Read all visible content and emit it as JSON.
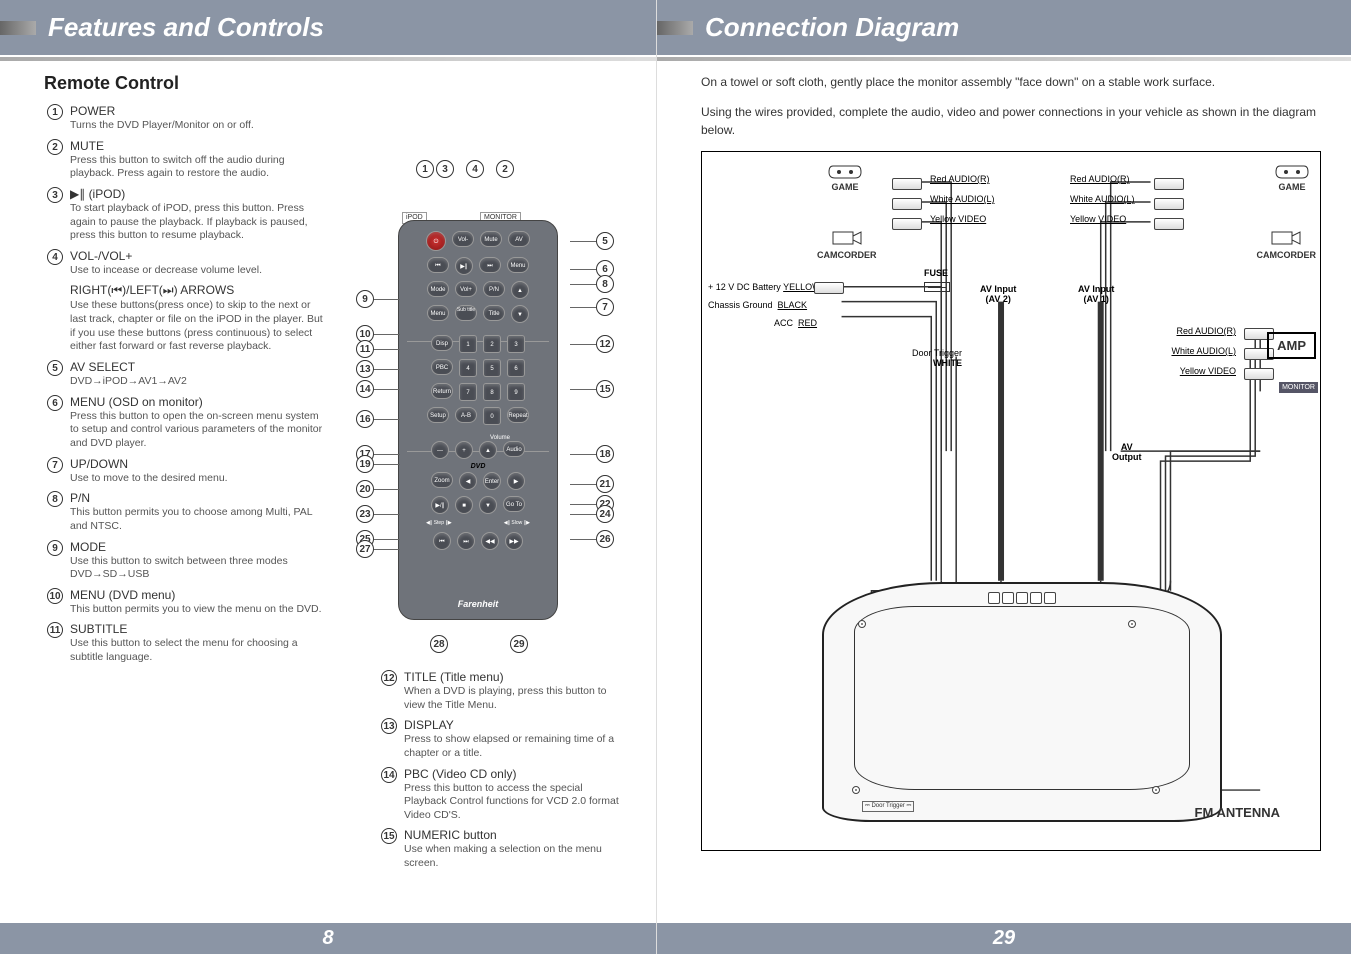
{
  "left": {
    "header": "Features and Controls",
    "section": "Remote Control",
    "pagenum": "8",
    "featuresA": [
      {
        "n": "1",
        "t": "POWER",
        "d": "Turns the DVD Player/Monitor on or off."
      },
      {
        "n": "2",
        "t": "MUTE",
        "d": "Press this button to switch off the audio during playback. Press again to restore the audio."
      },
      {
        "n": "3",
        "t": "▶∥ (iPOD)",
        "d": "To start playback of iPOD, press this button. Press again to pause the playback. If playback is paused, press this button to resume playback."
      },
      {
        "n": "4",
        "t": "VOL-/VOL+",
        "d": "Use to incease or decrease volume level."
      },
      {
        "n": "",
        "t": "RIGHT(⏮)/LEFT(⏭) ARROWS",
        "d": "Use these buttons(press once) to skip to the next or last track, chapter or file on the iPOD in the player. But if you use these buttons (press continuous) to select either fast forward or fast reverse playback."
      },
      {
        "n": "5",
        "t": "AV SELECT",
        "d": "DVD→iPOD→AV1→AV2"
      },
      {
        "n": "6",
        "t": "MENU (OSD on monitor)",
        "d": "Press this button to open the on-screen menu system to setup and control various parameters of the monitor and DVD player."
      },
      {
        "n": "7",
        "t": "UP/DOWN",
        "d": "Use to move to the desired menu."
      },
      {
        "n": "8",
        "t": "P/N",
        "d": "This button permits you to choose among Multi, PAL and NTSC."
      },
      {
        "n": "9",
        "t": "MODE",
        "d": "Use this button to switch between three modes\nDVD→SD→USB"
      },
      {
        "n": "10",
        "t": "MENU (DVD menu)",
        "d": "This button permits you to view the menu on the DVD."
      },
      {
        "n": "11",
        "t": "SUBTITLE",
        "d": "Use this button to select the menu for choosing a subtitle language."
      }
    ],
    "featuresB": [
      {
        "n": "12",
        "t": "TITLE (Title menu)",
        "d": "When a DVD is playing, press this button to view the Title Menu."
      },
      {
        "n": "13",
        "t": "DISPLAY",
        "d": "Press to show elapsed or remaining time of a chapter or a title."
      },
      {
        "n": "14",
        "t": "PBC (Video CD only)",
        "d": "Press this button to access the special Playback Control functions for VCD 2.0 format Video CD'S."
      },
      {
        "n": "15",
        "t": "NUMERIC button",
        "d": "Use when making a selection on the menu screen."
      }
    ],
    "remote": {
      "panel_ipod": "iPOD",
      "panel_monitor": "MONITOR",
      "logo": "Farenheit",
      "bottom_callouts": [
        "28",
        "29"
      ],
      "top_callouts": [
        "1",
        "3",
        "4",
        "2"
      ],
      "btns": {
        "power": "⏻",
        "volminus": "Vol-",
        "mute": "Mute",
        "av": "AV",
        "prev": "⏮",
        "playpause": "▶∥",
        "next": "⏭",
        "menu": "Menu",
        "mode": "Mode",
        "volplus": "Vol+",
        "pn": "P/N",
        "up": "▲",
        "menu2": "Menu",
        "subtitle": "Sub\ntitle",
        "title": "Title",
        "down": "▼",
        "disp": "Disp",
        "n1": "1",
        "n2": "2",
        "n3": "3",
        "pbc": "PBC",
        "n4": "4",
        "n5": "5",
        "n6": "6",
        "return": "Return",
        "n7": "7",
        "n8": "8",
        "n9": "9",
        "setup": "Setup",
        "ab": "A-B",
        "n0": "0",
        "repeat": "Repeat",
        "volume_lbl": "Volume",
        "minus": "—",
        "plus": "+",
        "aup": "▲",
        "audio": "Audio",
        "dvd_lbl": "DVD",
        "zoom": "Zoom",
        "left": "◀",
        "enter": "Enter",
        "right": "▶",
        "play2": "▶/∥",
        "stop": "■",
        "adown": "▼",
        "goto": "Go To",
        "step_l": "◀∥ Step ∥▶",
        "slow_l": "◀∥ Slow ∥▶",
        "skprev": "⏮",
        "sknext": "⏭",
        "rew": "◀◀",
        "ff": "▶▶"
      },
      "left_callouts": [
        "9",
        "10",
        "11",
        "13",
        "14",
        "16",
        "17",
        "19",
        "20",
        "23",
        "25",
        "27"
      ],
      "right_callouts": [
        "5",
        "6",
        "8",
        "7",
        "12",
        "15",
        "18",
        "21",
        "22",
        "24",
        "26"
      ]
    }
  },
  "right": {
    "header": "Connection Diagram",
    "pagenum": "29",
    "intro1": "On a towel or soft cloth, gently place the monitor assembly \"face down\" on a stable work surface.",
    "intro2": "Using the wires provided, complete the audio, video and power connections in your vehicle as shown in the diagram below.",
    "labels": {
      "game_l": "GAME",
      "camcorder_l": "CAMCORDER",
      "game_r": "GAME",
      "camcorder_r": "CAMCORDER",
      "red_audio_r": "Red  AUDIO(R)",
      "white_audio_l": "White  AUDIO(L)",
      "yellow_video": "Yellow  VIDEO",
      "fuse": "FUSE",
      "battery": "+ 12 V DC Battery",
      "yellow": "YELLOW",
      "black": "BLACK",
      "red": "RED",
      "chassis": "Chassis Ground",
      "acc": "ACC",
      "door": "Door Trigger",
      "door_color": "WHITE",
      "avin2": "AV Input\n(AV 2)",
      "avin1": "AV Input\n(AV 1)",
      "avout": "AV\nOutput",
      "amp": "AMP",
      "monitor": "MONITOR",
      "fm": "FM ANTENNA"
    }
  }
}
